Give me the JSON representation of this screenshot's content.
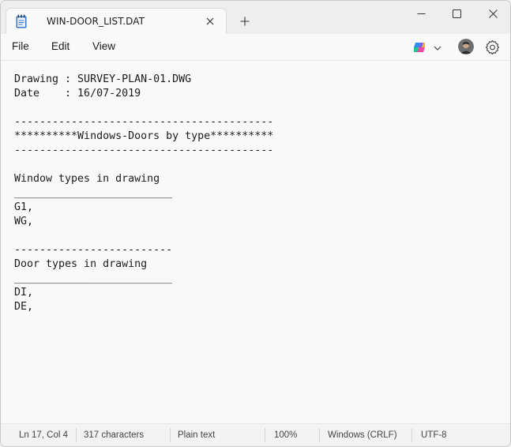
{
  "tab": {
    "title": "WIN-DOOR_LIST.DAT",
    "icon": "notepad-icon"
  },
  "menu": {
    "file": "File",
    "edit": "Edit",
    "view": "View"
  },
  "editor": {
    "content": "Drawing : SURVEY-PLAN-01.DWG\nDate    : 16/07-2019\n\n-----------------------------------------\n**********Windows-Doors by type**********\n-----------------------------------------\n\nWindow types in drawing\n_________________________\nG1,\nWG,\n\n-------------------------\nDoor types in drawing\n_________________________\nDI,\nDE,"
  },
  "status": {
    "position": "Ln 17, Col 4",
    "characters": "317 characters",
    "format": "Plain text",
    "zoom": "100%",
    "line_ending": "Windows (CRLF)",
    "encoding": "UTF-8"
  },
  "colors": {
    "accent_notepad": "#2f6fbf",
    "background": "#f9f9f9"
  }
}
